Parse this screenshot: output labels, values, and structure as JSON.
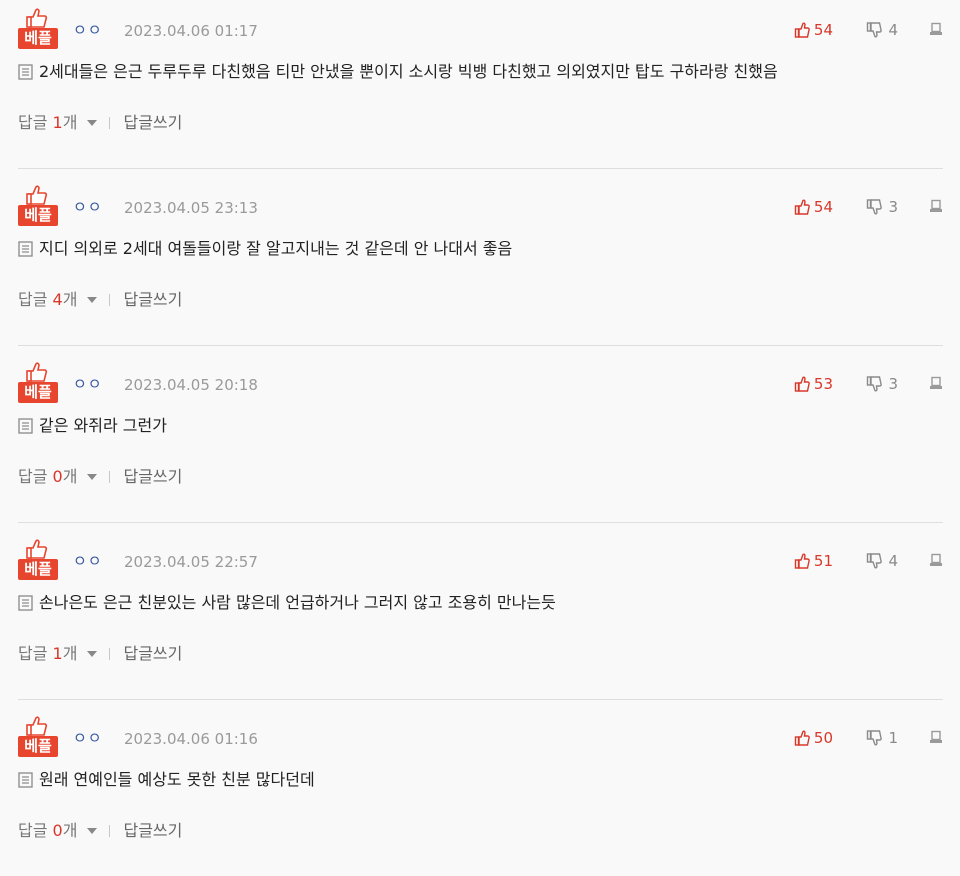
{
  "colors": {
    "accent_red": "#e8452f",
    "like_red": "#d8382a",
    "nick_blue": "#3a5aa0",
    "divider": "#dedede"
  },
  "labels": {
    "badge": "베플",
    "reply_prefix": "답글",
    "reply_suffix": "개",
    "write_reply": "답글쓰기"
  },
  "icons": {
    "badge": "thumbs-up-icon",
    "like": "thumbs-up-icon",
    "dislike": "thumbs-down-icon",
    "report": "report-icon",
    "doc": "document-icon",
    "caret": "caret-down-icon"
  },
  "comments": [
    {
      "nick": "ㅇㅇ",
      "date": "2023.04.06 01:17",
      "likes": "54",
      "dislikes": "4",
      "text": "2세대들은 은근 두루두루 다친했음 티만 안냈을 뿐이지 소시랑 빅뱅 다친했고 의외였지만 탑도 구하라랑 친했음",
      "replies": "1"
    },
    {
      "nick": "ㅇㅇ",
      "date": "2023.04.05 23:13",
      "likes": "54",
      "dislikes": "3",
      "text": "지디 의외로 2세대 여돌들이랑 잘 알고지내는 것 같은데 안 나대서 좋음",
      "replies": "4"
    },
    {
      "nick": "ㅇㅇ",
      "date": "2023.04.05 20:18",
      "likes": "53",
      "dislikes": "3",
      "text": "같은 와쥐라 그런가",
      "replies": "0"
    },
    {
      "nick": "ㅇㅇ",
      "date": "2023.04.05 22:57",
      "likes": "51",
      "dislikes": "4",
      "text": "손나은도 은근 친분있는 사람 많은데 언급하거나 그러지 않고 조용히 만나는듯",
      "replies": "1"
    },
    {
      "nick": "ㅇㅇ",
      "date": "2023.04.06 01:16",
      "likes": "50",
      "dislikes": "1",
      "text": "원래 연예인들 예상도 못한 친분 많다던데",
      "replies": "0"
    }
  ]
}
